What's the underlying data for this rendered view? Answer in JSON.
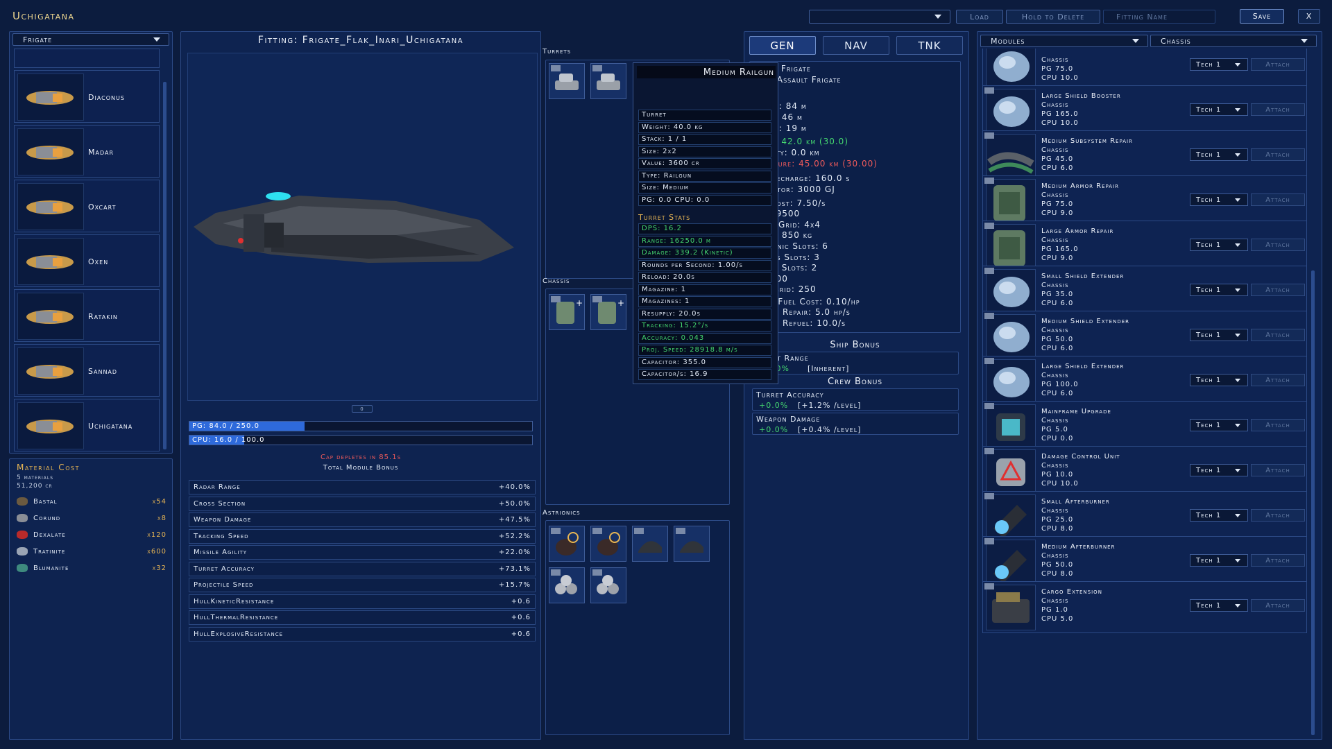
{
  "app": {
    "title": "Uchigatana"
  },
  "topbar": {
    "load": "Load",
    "hold_to_delete": "Hold to Delete",
    "fitting_name_placeholder": "Fitting Name",
    "save": "Save",
    "close": "X",
    "loadout_select": ""
  },
  "left": {
    "class_select": "Frigate",
    "ships": [
      {
        "name": "Diaconus"
      },
      {
        "name": "Madar"
      },
      {
        "name": "Oxcart"
      },
      {
        "name": "Oxen"
      },
      {
        "name": "Ratakin"
      },
      {
        "name": "Sannad"
      },
      {
        "name": "Uchigatana"
      }
    ]
  },
  "materials": {
    "title": "Material Cost",
    "count": "5 materials",
    "total": "51,200 cr",
    "items": [
      {
        "name": "Bastal",
        "qty": "x54",
        "color": "#6b5a40"
      },
      {
        "name": "Corund",
        "qty": "x8",
        "color": "#8a8e96"
      },
      {
        "name": "Dexalate",
        "qty": "x120",
        "color": "#b82a2a"
      },
      {
        "name": "Tratinite",
        "qty": "x600",
        "color": "#9aa4b4"
      },
      {
        "name": "Blumanite",
        "qty": "x32",
        "color": "#3e8a7e"
      }
    ]
  },
  "fitting": {
    "title": "Fitting: Frigate_Flak_Inari_Uchigatana",
    "zoom_button": "0",
    "pg": {
      "text": "PG: 84.0 / 250.0",
      "fill": 0.336
    },
    "cpu": {
      "text": "CPU: 16.0 / 100.0",
      "fill": 0.16
    },
    "cap_warning": "Cap depletes in 85.1s",
    "total_bonus_title": "Total Module Bonus",
    "bonuses": [
      {
        "label": "Radar Range",
        "value": "+40.0%"
      },
      {
        "label": "Cross Section",
        "value": "+50.0%"
      },
      {
        "label": "Weapon Damage",
        "value": "+47.5%"
      },
      {
        "label": "Tracking Speed",
        "value": "+52.2%"
      },
      {
        "label": "Missile Agility",
        "value": "+22.0%"
      },
      {
        "label": "Turret Accuracy",
        "value": "+73.1%"
      },
      {
        "label": "Projectile Speed",
        "value": "+15.7%"
      },
      {
        "label": "HullKineticResistance",
        "value": "+0.6"
      },
      {
        "label": "HullThermalResistance",
        "value": "+0.6"
      },
      {
        "label": "HullExplosiveResistance",
        "value": "+0.6"
      }
    ]
  },
  "slots": {
    "turrets_label": "Turrets",
    "chassis_label": "Chassis",
    "astrionics_label": "Astrionics"
  },
  "tooltip": {
    "name": "Medium Railgun",
    "rows": [
      "Turret",
      "Weight: 40.0 kg",
      "Stack: 1 / 1",
      "Size: 2x2",
      "Value: 3600 cr",
      "Type: Railgun",
      "Size: Medium",
      "PG: 0.0   CPU: 0.0"
    ],
    "stats_title": "Turret Stats",
    "stats": [
      {
        "t": "DPS: 16.2",
        "c": "g"
      },
      {
        "t": "Range: 16250.0 m",
        "c": "g"
      },
      {
        "t": "Damage: 339.2 (Kinetic)",
        "c": "g"
      },
      {
        "t": "Rounds per Second: 1.00/s",
        "c": "w"
      },
      {
        "t": "Reload: 20.0s",
        "c": "w"
      },
      {
        "t": "Magazine: 1",
        "c": "w"
      },
      {
        "t": "Magazines: 1",
        "c": "w"
      },
      {
        "t": "Resupply: 20.0s",
        "c": "w"
      },
      {
        "t": "Tracking: 15.2°/s",
        "c": "g"
      },
      {
        "t": "Accuracy: 0.043",
        "c": "g"
      },
      {
        "t": "Proj. Speed: 28918.8 m/s",
        "c": "g"
      },
      {
        "t": "Capacitor: 355.0",
        "c": "w"
      },
      {
        "t": "Capacitor/s: 16.9",
        "c": "w"
      }
    ]
  },
  "gen": {
    "tabs": [
      "GEN",
      "NAV",
      "TNK"
    ],
    "lines": [
      {
        "t": "s: Frigate",
        "c": "w"
      },
      {
        "t": ": Assault Frigate",
        "c": "w"
      },
      {
        "t": "th: 84 m",
        "c": "w"
      },
      {
        "t": "h: 46 m",
        "c": "w"
      },
      {
        "t": "ht: 19 m",
        "c": "w"
      },
      {
        "t": "r: 42.0 km (30.0)",
        "c": "g"
      },
      {
        "t": "lity: 0.0 km",
        "c": "w"
      },
      {
        "t": "ature: 45.00 km (30.00)",
        "c": "r"
      },
      {
        "t": "Recharge: 160.0 s",
        "c": "w"
      },
      {
        "t": "citor: 3000 GJ",
        "c": "w"
      },
      {
        "t": "Cost: 7.50/s",
        "c": "w"
      },
      {
        "t": " 19500",
        "c": "w"
      },
      {
        "t": "d Grid: 4x4",
        "c": "w"
      },
      {
        "t": "d: 850 kg",
        "c": "w"
      },
      {
        "t": "ionic Slots: 6",
        "c": "w"
      },
      {
        "t": "sis Slots: 3",
        "c": "w"
      },
      {
        "t": "et Slots: 2",
        "c": "w"
      },
      {
        "t": " 100",
        "c": "w"
      },
      {
        "t": "rgrid: 250",
        "c": "w"
      },
      {
        "t": "r Fuel Cost: 0.10/hp",
        "c": "w"
      },
      {
        "t": "ed Repair: 5.0 hp/s",
        "c": "w"
      },
      {
        "t": "ed Refuel: 10.0/s",
        "c": "w"
      }
    ],
    "ship_bonus_title": "Ship Bonus",
    "ship_bonus_name": "et Range",
    "ship_bonus_value": ".0%",
    "ship_bonus_note": "[Inherent]",
    "crew_bonus_title": "Crew Bonus",
    "crew": [
      {
        "name": "Turret Accuracy",
        "value": "+0.0%",
        "note": "[+1.2% /level]"
      },
      {
        "name": "Weapon Damage",
        "value": "+0.0%",
        "note": "[+0.4% /level]"
      }
    ]
  },
  "modules": {
    "filter1": "Modules",
    "filter2": "Chassis",
    "tech_label": "Tech 1",
    "attach_label": "Attach",
    "items": [
      {
        "name": "",
        "cat": "Chassis",
        "pg": "PG 75.0",
        "cpu": "CPU 10.0",
        "red": false,
        "kind": "shield"
      },
      {
        "name": "Large Shield Booster",
        "cat": "Chassis",
        "pg": "PG 165.0",
        "cpu": "CPU 10.0",
        "red": true,
        "kind": "shield"
      },
      {
        "name": "Medium Subsystem Repair",
        "cat": "Chassis",
        "pg": "PG 45.0",
        "cpu": "CPU 6.0",
        "red": false,
        "kind": "pipe"
      },
      {
        "name": "Medium Armor Repair",
        "cat": "Chassis",
        "pg": "PG 75.0",
        "cpu": "CPU 9.0",
        "red": false,
        "kind": "armor"
      },
      {
        "name": "Large Armor Repair",
        "cat": "Chassis",
        "pg": "PG 165.0",
        "cpu": "CPU 9.0",
        "red": true,
        "kind": "armor"
      },
      {
        "name": "Small Shield Extender",
        "cat": "Chassis",
        "pg": "PG 35.0",
        "cpu": "CPU 6.0",
        "red": false,
        "kind": "shield"
      },
      {
        "name": "Medium Shield Extender",
        "cat": "Chassis",
        "pg": "PG 50.0",
        "cpu": "CPU 6.0",
        "red": false,
        "kind": "shield"
      },
      {
        "name": "Large Shield Extender",
        "cat": "Chassis",
        "pg": "PG 100.0",
        "cpu": "CPU 6.0",
        "red": true,
        "kind": "shield"
      },
      {
        "name": "Mainframe Upgrade",
        "cat": "Chassis",
        "pg": "PG 5.0",
        "cpu": "CPU 0.0",
        "red": false,
        "kind": "chip"
      },
      {
        "name": "Damage Control Unit",
        "cat": "Chassis",
        "pg": "PG 10.0",
        "cpu": "CPU 10.0",
        "red": false,
        "kind": "dcu"
      },
      {
        "name": "Small Afterburner",
        "cat": "Chassis",
        "pg": "PG 25.0",
        "cpu": "CPU 8.0",
        "red": false,
        "kind": "ab"
      },
      {
        "name": "Medium Afterburner",
        "cat": "Chassis",
        "pg": "PG 50.0",
        "cpu": "CPU 8.0",
        "red": false,
        "kind": "ab"
      },
      {
        "name": "Cargo Extension",
        "cat": "Chassis",
        "pg": "PG 1.0",
        "cpu": "CPU 5.0",
        "red": false,
        "kind": "cargo"
      }
    ]
  }
}
